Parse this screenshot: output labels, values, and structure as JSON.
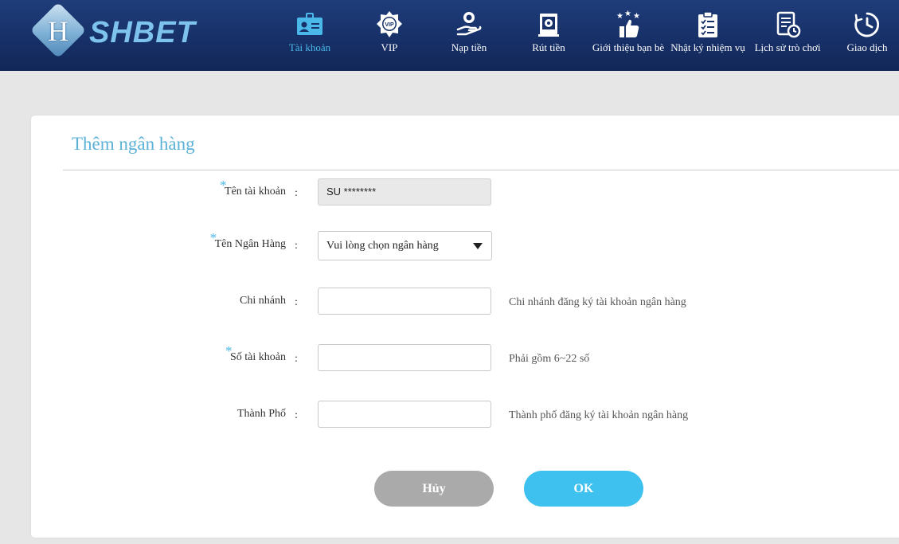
{
  "brand": {
    "monogram": "H",
    "name": "SHBET"
  },
  "nav": [
    {
      "label": "Tài khoản",
      "icon": "account-card-icon"
    },
    {
      "label": "VIP",
      "icon": "vip-badge-icon"
    },
    {
      "label": "Nạp tiền",
      "icon": "deposit-hand-coin-icon"
    },
    {
      "label": "Rút tiền",
      "icon": "withdraw-safe-icon"
    },
    {
      "label": "Giới thiệu bạn bè",
      "icon": "referral-thumbs-up-icon"
    },
    {
      "label": "Nhật ký nhiệm vụ",
      "icon": "task-clipboard-icon"
    },
    {
      "label": "Lịch sử trò chơi",
      "icon": "game-history-icon"
    },
    {
      "label": "Giao dịch",
      "icon": "transaction-clock-icon"
    }
  ],
  "nav_active_index": 0,
  "form": {
    "title": "Thêm ngân hàng",
    "required_mark": "*",
    "colon": ":",
    "account_name": {
      "label": "Tên tài khoản",
      "value": "SU ********"
    },
    "bank_name": {
      "label": "Tên Ngân Hàng",
      "value": "Vui lòng chọn ngân hàng"
    },
    "branch": {
      "label": "Chi nhánh",
      "value": "",
      "hint": "Chi nhánh đăng ký tài khoản ngân hàng"
    },
    "account_number": {
      "label": "Số tài khoản",
      "value": "",
      "hint": "Phải gồm 6~22 số"
    },
    "city": {
      "label": "Thành Phố",
      "value": "",
      "hint": "Thành phố đăng ký tài khoản ngân hàng"
    },
    "cancel_label": "Hủy",
    "ok_label": "OK"
  },
  "colors": {
    "header_bg": "#173068",
    "accent": "#4ab8e8",
    "title": "#5bb1d8",
    "ok_button": "#3ec1ef",
    "cancel_button": "#aaaaaa",
    "page_bg": "#e6e6e6"
  }
}
